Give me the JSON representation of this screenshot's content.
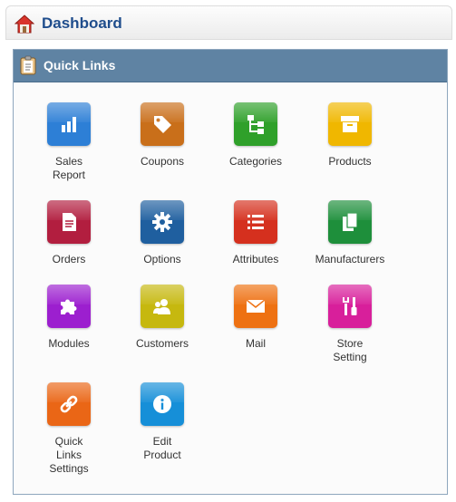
{
  "header": {
    "title": "Dashboard"
  },
  "panel": {
    "title": "Quick Links"
  },
  "links": [
    {
      "label": "Sales\nReport",
      "icon": "bar-chart-icon",
      "color": "#2d7fd6"
    },
    {
      "label": "Coupons",
      "icon": "tag-icon",
      "color": "#c96f1a"
    },
    {
      "label": "Categories",
      "icon": "tree-icon",
      "color": "#2fa02a"
    },
    {
      "label": "Products",
      "icon": "box-icon",
      "color": "#f0b700"
    },
    {
      "label": "Orders",
      "icon": "document-icon",
      "color": "#b21e3f"
    },
    {
      "label": "Options",
      "icon": "gear-icon",
      "color": "#1f5f9f"
    },
    {
      "label": "Attributes",
      "icon": "list-icon",
      "color": "#d5301e"
    },
    {
      "label": "Manufacturers",
      "icon": "pages-icon",
      "color": "#1e8f3b"
    },
    {
      "label": "Modules",
      "icon": "puzzle-icon",
      "color": "#9c1fcf"
    },
    {
      "label": "Customers",
      "icon": "users-icon",
      "color": "#c6b80f"
    },
    {
      "label": "Mail",
      "icon": "envelope-icon",
      "color": "#ee7112"
    },
    {
      "label": "Store\nSetting",
      "icon": "tools-icon",
      "color": "#d81f9b"
    },
    {
      "label": "Quick\nLinks\nSettings",
      "icon": "link-icon",
      "color": "#ea6616"
    },
    {
      "label": "Edit\nProduct",
      "icon": "info-icon",
      "color": "#168fd8"
    }
  ]
}
